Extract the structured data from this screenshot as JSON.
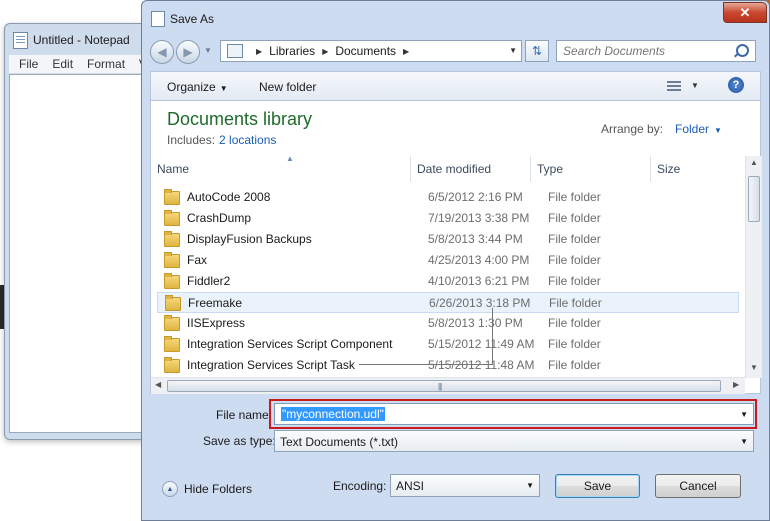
{
  "notepad": {
    "title": "Untitled - Notepad",
    "menu": [
      "File",
      "Edit",
      "Format",
      "V"
    ]
  },
  "dialog": {
    "title": "Save As",
    "close_label": "✕",
    "address": {
      "crumbs": [
        "Libraries",
        "Documents"
      ]
    },
    "search_placeholder": "Search Documents",
    "toolbar": {
      "organize": "Organize",
      "new_folder": "New folder",
      "help": "?"
    },
    "library": {
      "title": "Documents library",
      "includes_label": "Includes:",
      "includes_link": "2 locations",
      "arrange_label": "Arrange by:",
      "arrange_value": "Folder"
    },
    "columns": [
      "Name",
      "Date modified",
      "Type",
      "Size"
    ],
    "rows": [
      {
        "name": "AutoCode 2008",
        "date": "6/5/2012 2:16 PM",
        "type": "File folder"
      },
      {
        "name": "CrashDump",
        "date": "7/19/2013 3:38 PM",
        "type": "File folder"
      },
      {
        "name": "DisplayFusion Backups",
        "date": "5/8/2013 3:44 PM",
        "type": "File folder"
      },
      {
        "name": "Fax",
        "date": "4/25/2013 4:00 PM",
        "type": "File folder"
      },
      {
        "name": "Fiddler2",
        "date": "4/10/2013 6:21 PM",
        "type": "File folder"
      },
      {
        "name": "Freemake",
        "date": "6/26/2013 3:18 PM",
        "type": "File folder",
        "selected": true
      },
      {
        "name": "IISExpress",
        "date": "5/8/2013 1:30 PM",
        "type": "File folder"
      },
      {
        "name": "Integration Services Script Component",
        "date": "5/15/2012 11:49 AM",
        "type": "File folder"
      },
      {
        "name": "Integration Services Script Task",
        "date": "5/15/2012 11:48 AM",
        "type": "File folder"
      }
    ],
    "file_name_label": "File name:",
    "file_name_value": "\"myconnection.udl\"",
    "save_type_label": "Save as type:",
    "save_type_value": "Text Documents (*.txt)",
    "hide_folders": "Hide Folders",
    "encoding_label": "Encoding:",
    "encoding_value": "ANSI",
    "save_button": "Save",
    "cancel_button": "Cancel",
    "colors": {
      "library_title": "#1e6b2b",
      "link": "#1a5cb5",
      "selection": "#3399ff",
      "highlight_box": "#c81c1c"
    }
  }
}
